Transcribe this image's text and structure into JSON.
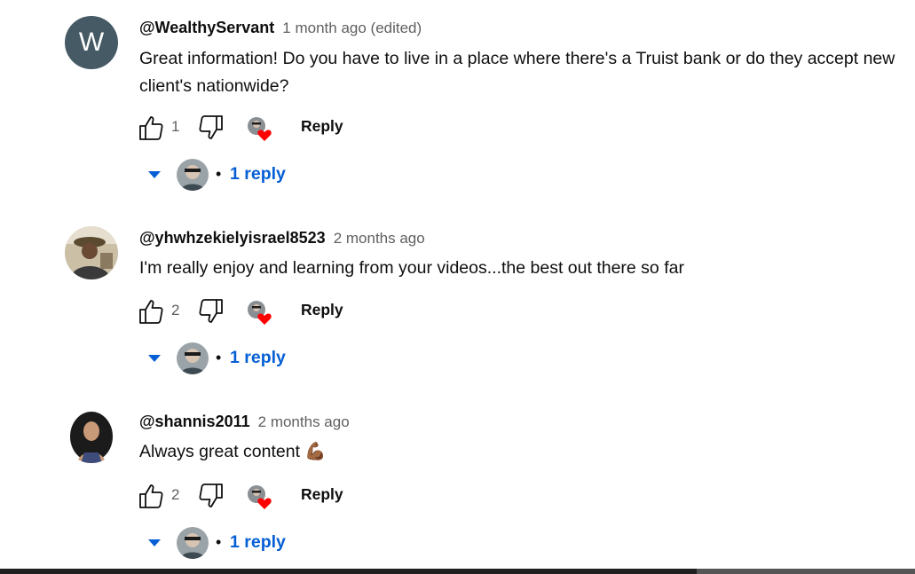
{
  "comments": [
    {
      "avatar_letter": "W",
      "author": "@WealthyServant",
      "time": "1 month ago (edited)",
      "text": "Great information! Do you have to live in a place where there's a Truist bank or do they accept new client's nationwide?",
      "likes": "1",
      "reply_label": "Reply",
      "replies_label": "1 reply",
      "dot": "•"
    },
    {
      "author": "@yhwhzekielyisrael8523",
      "time": "2 months ago",
      "text": "I'm really enjoy and learning from your videos...the best out there so far",
      "likes": "2",
      "reply_label": "Reply",
      "replies_label": "1 reply",
      "dot": "•"
    },
    {
      "author": "@shannis2011",
      "time": "2 months ago",
      "text": "Always great content 💪🏾",
      "likes": "2",
      "reply_label": "Reply",
      "replies_label": "1 reply",
      "dot": "•"
    }
  ],
  "colors": {
    "link_blue": "#065fd4",
    "heart_red": "#ff0000",
    "avatar_letter_bg": "#455a64",
    "meta_gray": "#606060"
  },
  "icons": {
    "like": "thumbs-up-icon",
    "dislike": "thumbs-down-icon",
    "creator_heart": "creator-heart-icon",
    "expand": "chevron-down-icon"
  }
}
